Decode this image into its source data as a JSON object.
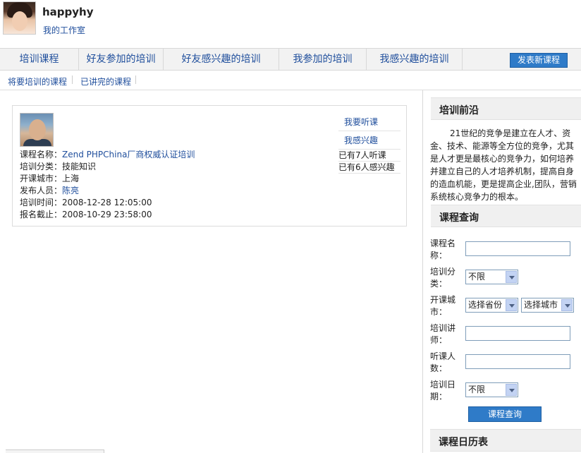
{
  "user": {
    "name": "happyhy",
    "studio_link": "我的工作室"
  },
  "main_nav": {
    "tabs": [
      "培训课程",
      "好友参加的培训",
      "好友感兴趣的培训",
      "我参加的培训",
      "我感兴趣的培训"
    ],
    "publish_button": "发表新课程"
  },
  "sub_nav": {
    "items": [
      "将要培训的课程",
      "已讲完的课程"
    ]
  },
  "course": {
    "labels": {
      "name": "课程名称：",
      "category": "培训分类：",
      "city": "开课城市：",
      "publisher": "发布人员：",
      "time": "培训时间：",
      "deadline": "报名截止："
    },
    "name": "Zend PHPChina厂商权威认证培训",
    "category": "技能知识",
    "city": "上海",
    "publisher": "陈亮",
    "time": "2008-12-28 12:05:00",
    "deadline": "2008-10-29 23:58:00",
    "actions": {
      "attend": "我要听课",
      "interested": "我感兴趣"
    },
    "stats": {
      "attending": "已有7人听课",
      "interested": "已有6人感兴趣"
    }
  },
  "sidebar": {
    "frontier": {
      "title": "培训前沿",
      "text": "21世纪的竞争是建立在人才、资金、技术、能源等全方位的竞争，尤其是人才更是最核心的竞争力，如何培养并建立自己的人才培养机制，提高自身的造血机能，更是提高企业,团队，营销系统核心竞争力的根本。"
    },
    "query": {
      "title": "课程查询",
      "labels": {
        "course_name": "课程名称：",
        "category": "培训分类：",
        "city": "开课城市：",
        "teacher": "培训讲师：",
        "audience": "听课人数：",
        "date": "培训日期："
      },
      "category_value": "不限",
      "province_value": "选择省份",
      "city_value": "选择城市",
      "date_value": "不限",
      "submit": "课程查询"
    },
    "calendar": {
      "title": "课程日历表"
    }
  }
}
